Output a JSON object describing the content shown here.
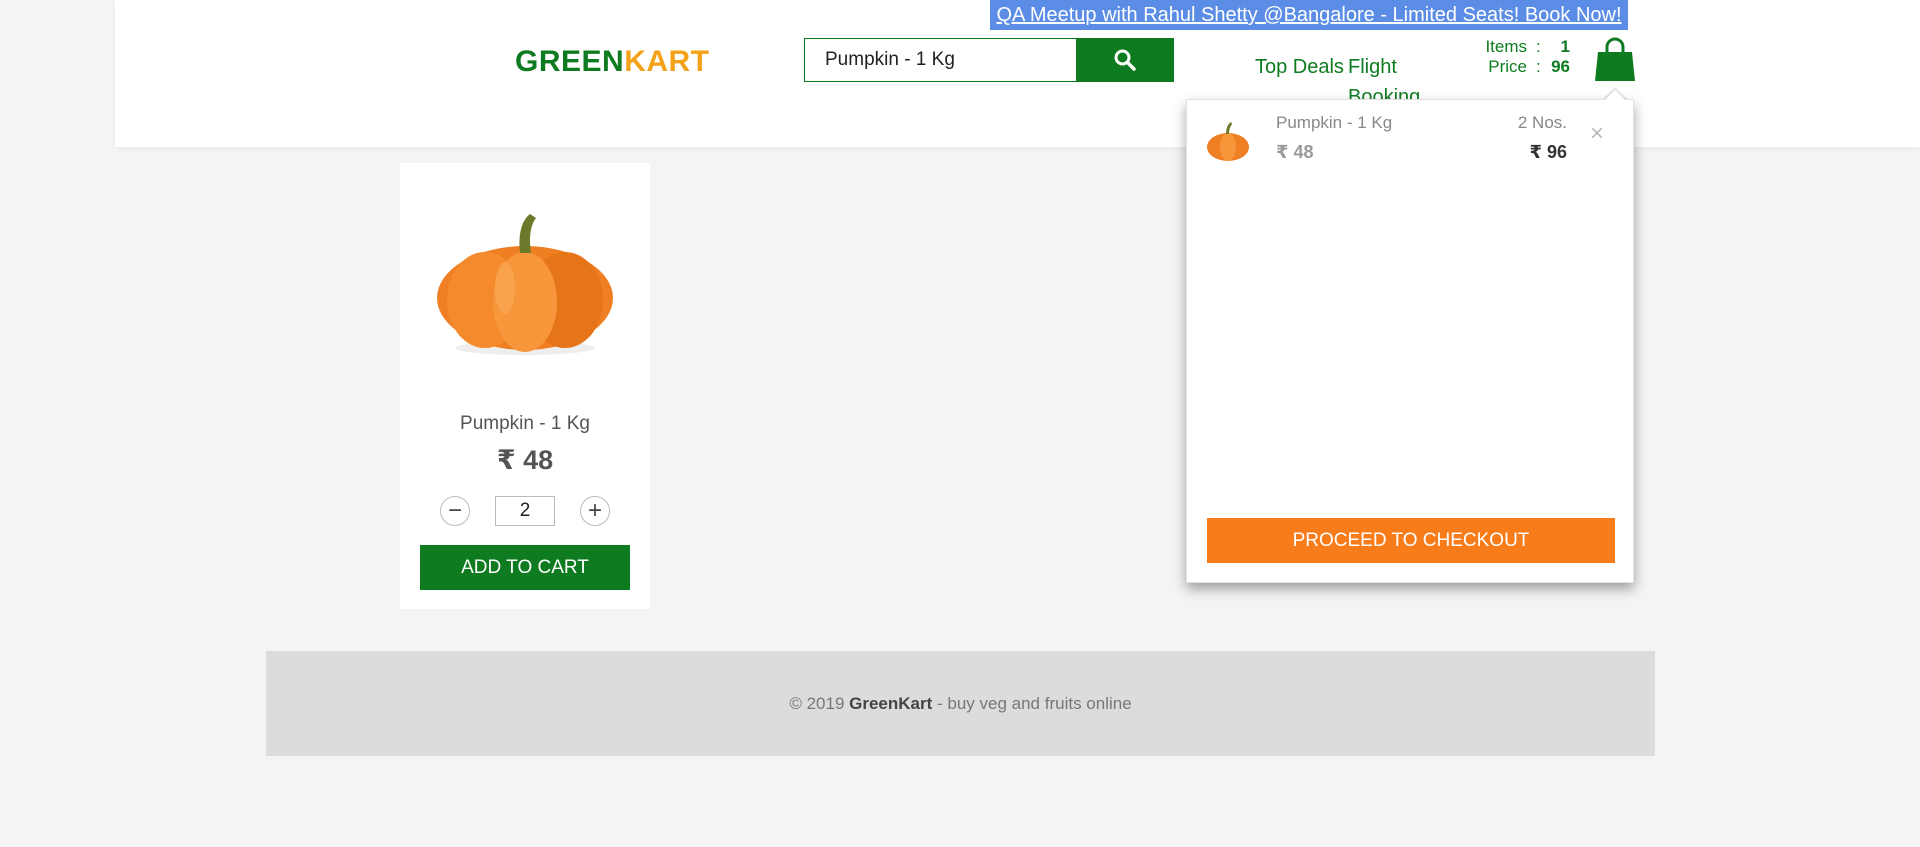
{
  "promo": {
    "text": "QA Meetup with Rahul Shetty @Bangalore - Limited Seats! Book Now!"
  },
  "header": {
    "logo": {
      "part1": "GREEN",
      "part2": "KART"
    },
    "search": {
      "value": "Pumpkin - 1 Kg",
      "icon": "search-icon"
    },
    "nav": [
      {
        "label": "Top Deals"
      },
      {
        "label": "Flight Booking"
      }
    ],
    "cart_info": {
      "items_label": "Items",
      "items_value": "1",
      "price_label": "Price",
      "price_value": "96",
      "separator": ":"
    },
    "cart_icon": "shopping-bag-icon"
  },
  "product": {
    "name": "Pumpkin - 1 Kg",
    "price": "₹ 48",
    "quantity": "2",
    "decrement": "−",
    "increment": "+",
    "add_label": "ADD TO CART"
  },
  "cart_preview": {
    "items": [
      {
        "name": "Pumpkin - 1 Kg",
        "price": "₹ 48",
        "quantity": "2 Nos.",
        "amount": "₹ 96"
      }
    ],
    "remove_symbol": "×",
    "checkout_label": "PROCEED TO CHECKOUT"
  },
  "footer": {
    "prefix": "© 2019 ",
    "brand": "GreenKart",
    "suffix": " - buy veg and fruits online"
  },
  "colors": {
    "brand_green": "#0f7b20",
    "brand_orange": "#f5a21b",
    "checkout_orange": "#f97c1b",
    "promo_blue": "#5b8de6"
  }
}
